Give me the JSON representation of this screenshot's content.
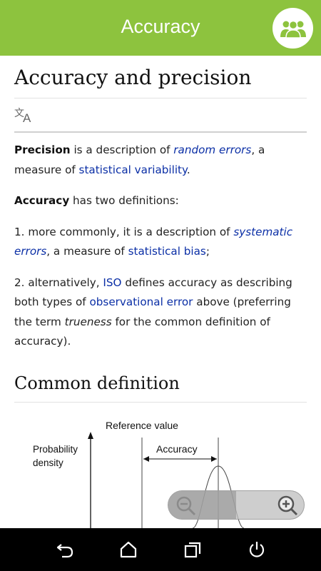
{
  "appbar": {
    "title": "Accuracy",
    "group_icon": "group-people-icon"
  },
  "article": {
    "title": "Accuracy and precision",
    "language_icon": "translate-icon",
    "p1": {
      "b1": "Precision",
      "t1": " is a description of ",
      "l1": "random errors",
      "t2": ", a measure of ",
      "l2": "statistical variability",
      "t3": "."
    },
    "p2": {
      "b1": "Accuracy",
      "t1": " has two definitions:"
    },
    "p3": {
      "t1": "1. more commonly, it is a description of ",
      "l1": "systematic errors",
      "t2": ", a measure of ",
      "l2": "statistical bias",
      "t3": ";"
    },
    "p4": {
      "t1": "2. alternatively, ",
      "l1": "ISO",
      "t2": " defines accuracy as describing both types of ",
      "l2": "observational error",
      "t3": " above (preferring the term ",
      "i1": "trueness",
      "t4": " for the common definition of accuracy)."
    },
    "section_title": "Common definition"
  },
  "figure": {
    "reference_label": "Reference value",
    "ylabel_1": "Probability",
    "ylabel_2": "density",
    "accuracy_label": "Accuracy"
  },
  "zoom": {
    "level": 0.5,
    "zoom_out_icon": "zoom-out-icon",
    "zoom_in_icon": "zoom-in-icon"
  },
  "navbar": {
    "icons": [
      "back-icon",
      "home-icon",
      "recents-icon",
      "power-icon"
    ]
  },
  "colors": {
    "appbar": "#8dc33e",
    "link": "#0b2fa6",
    "navbar": "#000000"
  }
}
